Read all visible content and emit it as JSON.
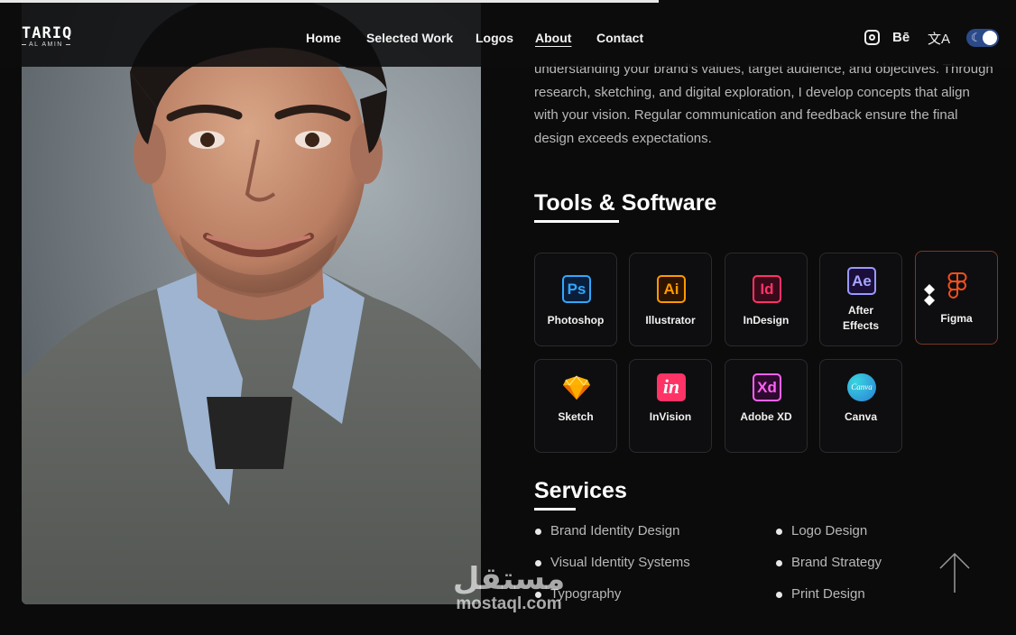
{
  "brand": {
    "name": "TARIQ",
    "subname": "AL AMIN"
  },
  "nav": {
    "home": "Home",
    "work": "Selected Work",
    "logos": "Logos",
    "about": "About",
    "contact": "Contact"
  },
  "header_icons": {
    "behance": "Bē",
    "translate": "文A"
  },
  "about": {
    "text": "understanding your brand's values, target audience, and objectives. Through research, sketching, and digital exploration, I develop concepts that align with your vision. Regular communication and feedback ensure the final design exceeds expectations."
  },
  "tools": {
    "title": "Tools & Software",
    "items": [
      {
        "abbr": "Ps",
        "label": "Photoshop"
      },
      {
        "abbr": "Ai",
        "label": "Illustrator"
      },
      {
        "abbr": "Id",
        "label": "InDesign"
      },
      {
        "abbr": "Ae",
        "label": "After Effects"
      },
      {
        "abbr": "",
        "label": "Figma"
      },
      {
        "abbr": "",
        "label": "Sketch"
      },
      {
        "abbr": "in",
        "label": "InVision"
      },
      {
        "abbr": "Xd",
        "label": "Adobe XD"
      },
      {
        "abbr": "Canva",
        "label": "Canva"
      }
    ]
  },
  "services": {
    "title": "Services",
    "items": [
      "Brand Identity Design",
      "Logo Design",
      "Visual Identity Systems",
      "Brand Strategy",
      "Typography",
      "Print Design"
    ]
  },
  "watermark": {
    "arabic": "مستقل",
    "latin": "mostaql.com"
  },
  "colors": {
    "background": "#0b0b0c",
    "accent_border": "#7a3822",
    "toggle": "#2b4a8a"
  }
}
